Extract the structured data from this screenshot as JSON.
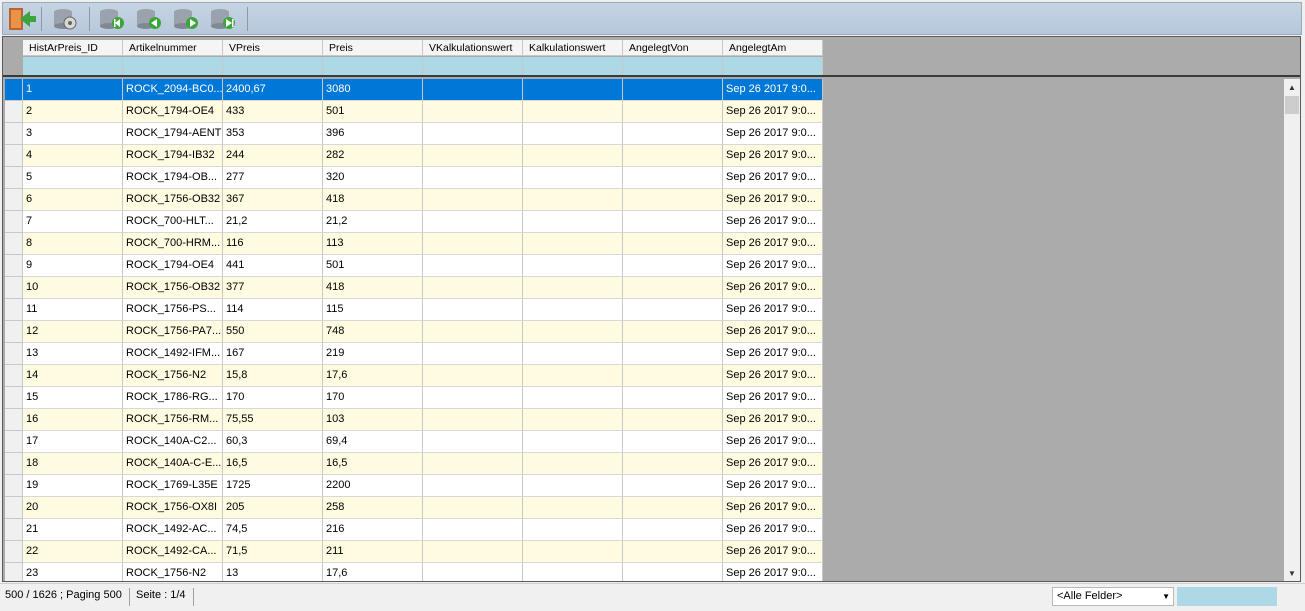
{
  "toolbar": {
    "buttons": [
      {
        "name": "exit-icon"
      },
      {
        "name": "database-settings-icon"
      },
      {
        "name": "database-first-icon"
      },
      {
        "name": "database-previous-icon"
      },
      {
        "name": "database-next-icon"
      },
      {
        "name": "database-last-icon"
      }
    ]
  },
  "grid": {
    "columns": [
      "HistArPreis_ID",
      "Artikelnummer",
      "VPreis",
      "Preis",
      "VKalkulationswert",
      "Kalkulationswert",
      "AngelegtVon",
      "AngelegtAm"
    ],
    "rows": [
      [
        "1",
        "ROCK_2094-BC0...",
        "2400,67",
        "3080",
        "",
        "",
        "",
        "Sep 26 2017  9:0..."
      ],
      [
        "2",
        "ROCK_1794-OE4",
        "433",
        "501",
        "",
        "",
        "",
        "Sep 26 2017  9:0..."
      ],
      [
        "3",
        "ROCK_1794-AENT",
        "353",
        "396",
        "",
        "",
        "",
        "Sep 26 2017  9:0..."
      ],
      [
        "4",
        "ROCK_1794-IB32",
        "244",
        "282",
        "",
        "",
        "",
        "Sep 26 2017  9:0..."
      ],
      [
        "5",
        "ROCK_1794-OB...",
        "277",
        "320",
        "",
        "",
        "",
        "Sep 26 2017  9:0..."
      ],
      [
        "6",
        "ROCK_1756-OB32",
        "367",
        "418",
        "",
        "",
        "",
        "Sep 26 2017  9:0..."
      ],
      [
        "7",
        "ROCK_700-HLT...",
        "21,2",
        "21,2",
        "",
        "",
        "",
        "Sep 26 2017  9:0..."
      ],
      [
        "8",
        "ROCK_700-HRM...",
        "116",
        "113",
        "",
        "",
        "",
        "Sep 26 2017  9:0..."
      ],
      [
        "9",
        "ROCK_1794-OE4",
        "441",
        "501",
        "",
        "",
        "",
        "Sep 26 2017  9:0..."
      ],
      [
        "10",
        "ROCK_1756-OB32",
        "377",
        "418",
        "",
        "",
        "",
        "Sep 26 2017  9:0..."
      ],
      [
        "11",
        "ROCK_1756-PS...",
        "114",
        "115",
        "",
        "",
        "",
        "Sep 26 2017  9:0..."
      ],
      [
        "12",
        "ROCK_1756-PA7...",
        "550",
        "748",
        "",
        "",
        "",
        "Sep 26 2017  9:0..."
      ],
      [
        "13",
        "ROCK_1492-IFM...",
        "167",
        "219",
        "",
        "",
        "",
        "Sep 26 2017  9:0..."
      ],
      [
        "14",
        "ROCK_1756-N2",
        "15,8",
        "17,6",
        "",
        "",
        "",
        "Sep 26 2017  9:0..."
      ],
      [
        "15",
        "ROCK_1786-RG...",
        "170",
        "170",
        "",
        "",
        "",
        "Sep 26 2017  9:0..."
      ],
      [
        "16",
        "ROCK_1756-RM...",
        "75,55",
        "103",
        "",
        "",
        "",
        "Sep 26 2017  9:0..."
      ],
      [
        "17",
        "ROCK_140A-C2...",
        "60,3",
        "69,4",
        "",
        "",
        "",
        "Sep 26 2017  9:0..."
      ],
      [
        "18",
        "ROCK_140A-C-E...",
        "16,5",
        "16,5",
        "",
        "",
        "",
        "Sep 26 2017  9:0..."
      ],
      [
        "19",
        "ROCK_1769-L35E",
        "1725",
        "2200",
        "",
        "",
        "",
        "Sep 26 2017  9:0..."
      ],
      [
        "20",
        "ROCK_1756-OX8I",
        "205",
        "258",
        "",
        "",
        "",
        "Sep 26 2017  9:0..."
      ],
      [
        "21",
        "ROCK_1492-AC...",
        "74,5",
        "216",
        "",
        "",
        "",
        "Sep 26 2017  9:0..."
      ],
      [
        "22",
        "ROCK_1492-CA...",
        "71,5",
        "211",
        "",
        "",
        "",
        "Sep 26 2017  9:0..."
      ],
      [
        "23",
        "ROCK_1756-N2",
        "13",
        "17,6",
        "",
        "",
        "",
        "Sep 26 2017  9:0..."
      ]
    ],
    "selected_row": 0
  },
  "status": {
    "count": "500 / 1626 ; Paging 500",
    "page": "Seite : 1/4",
    "field_filter": "<Alle Felder>"
  }
}
